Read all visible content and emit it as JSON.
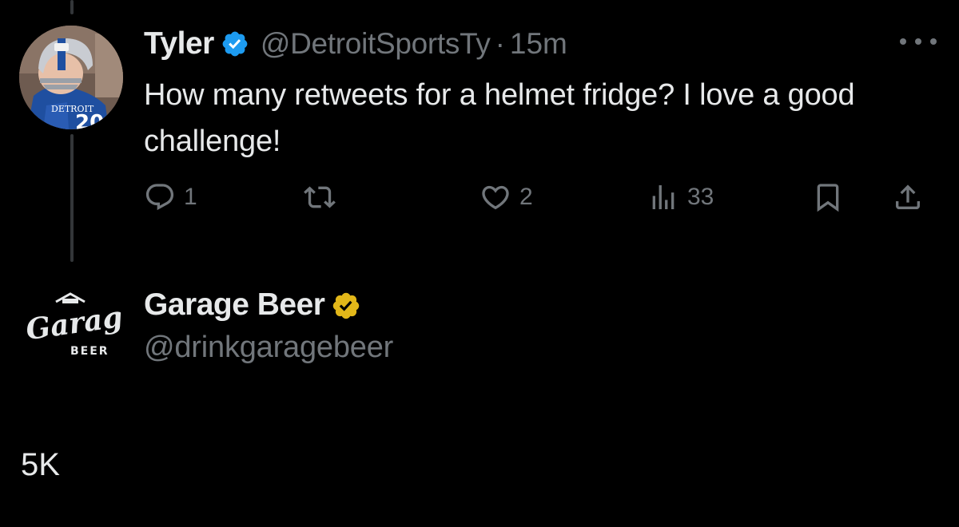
{
  "tweet": {
    "author_name": "Tyler",
    "verified_color": "#1d9bf0",
    "handle": "@DetroitSportsTy",
    "separator": "·",
    "timestamp": "15m",
    "text": "How many retweets for a helmet fridge? I love a good challenge!",
    "avatar_jersey_text": "DETROIT",
    "avatar_jersey_number": "20",
    "actions": {
      "reply_count": "1",
      "retweet_count": "",
      "like_count": "2",
      "views_count": "33"
    }
  },
  "reply": {
    "author_name": "Garage Beer",
    "verified_color": "#e2b719",
    "handle": "@drinkgaragebeer",
    "logo_text": "Garage",
    "logo_subtext": "BEER",
    "text": "5K"
  },
  "colors": {
    "background": "#000000",
    "primary_text": "#e7e9ea",
    "secondary_text": "#71767b",
    "thread_line": "#333639"
  }
}
